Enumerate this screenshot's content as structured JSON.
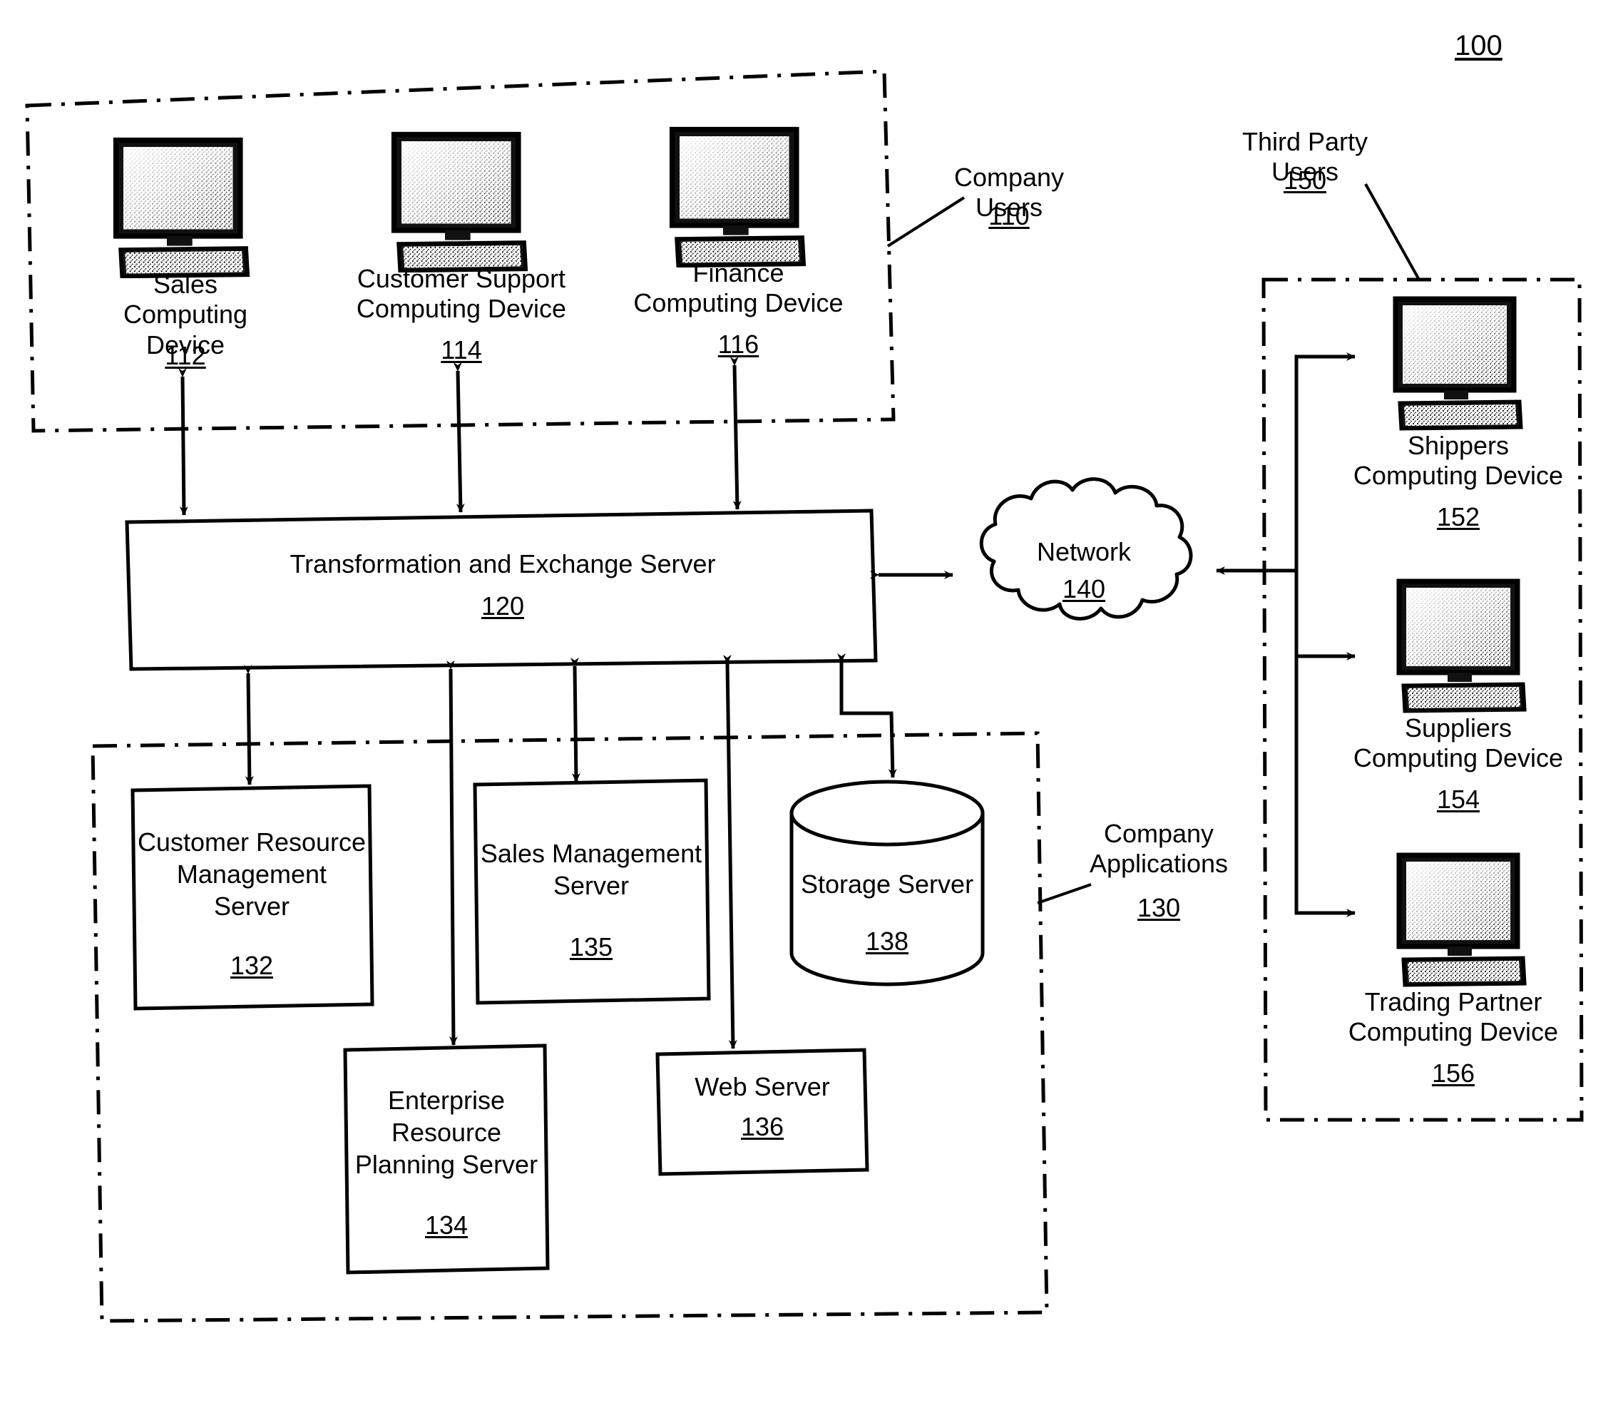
{
  "figure": {
    "number": "100"
  },
  "groups": {
    "company_users": {
      "name": "Company\nUsers",
      "ref": "110"
    },
    "third_party_users": {
      "name": "Third Party\nUsers",
      "ref": "150"
    },
    "company_applications": {
      "name": "Company\nApplications",
      "ref": "130"
    }
  },
  "company_user_devices": [
    {
      "name": "Sales\nComputing Device",
      "ref": "112",
      "icon": "desktop-computer-icon"
    },
    {
      "name": "Customer Support\nComputing Device",
      "ref": "114",
      "icon": "desktop-computer-icon"
    },
    {
      "name": "Finance\nComputing Device",
      "ref": "116",
      "icon": "desktop-computer-icon"
    }
  ],
  "third_party_devices": [
    {
      "name": "Shippers\nComputing Device",
      "ref": "152",
      "icon": "desktop-computer-icon"
    },
    {
      "name": "Suppliers\nComputing Device",
      "ref": "154",
      "icon": "desktop-computer-icon"
    },
    {
      "name": "Trading Partner\nComputing Device",
      "ref": "156",
      "icon": "desktop-computer-icon"
    }
  ],
  "central_server": {
    "name": "Transformation and Exchange Server",
    "ref": "120"
  },
  "network": {
    "name": "Network",
    "ref": "140",
    "icon": "cloud-icon"
  },
  "application_servers": [
    {
      "name": "Customer\nResource\nManagement\nServer",
      "ref": "132",
      "shape": "rectangle"
    },
    {
      "name": "Enterprise\nResource\nPlanning\nServer",
      "ref": "134",
      "shape": "rectangle"
    },
    {
      "name": "Sales\nManagement\nServer",
      "ref": "135",
      "shape": "rectangle"
    },
    {
      "name": "Web Server",
      "ref": "136",
      "shape": "rectangle"
    },
    {
      "name": "Storage\nServer",
      "ref": "138",
      "shape": "cylinder"
    }
  ],
  "colors": {
    "ink": "#000000",
    "paper": "#ffffff"
  }
}
